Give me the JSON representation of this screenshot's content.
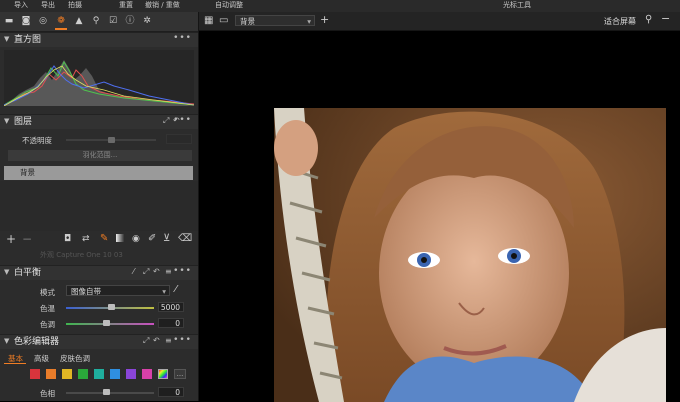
{
  "menu": {
    "import": "导入",
    "export": "导出",
    "capture": "拍摄",
    "reset": "重置",
    "undo_redo": "撤销 / 重做",
    "auto_adjust": "自动调整",
    "cursor_tools": "光标工具"
  },
  "tool_tabs": [
    "folder-icon",
    "camera-icon",
    "lens-icon",
    "color-icon",
    "exposure-icon",
    "details-icon",
    "adjustments-icon",
    "metadata-icon",
    "settings-icon"
  ],
  "histogram": {
    "title": "直方图",
    "more": "•••"
  },
  "layers": {
    "title": "图层",
    "opacity_label": "不透明度",
    "opacity_value": "",
    "feather_button": "羽化范围...",
    "background_layer": "背景",
    "more": "•••"
  },
  "white_balance": {
    "title": "白平衡",
    "partial_text": "外观    Capture One 10 03",
    "mode_label": "模式",
    "mode_value": "图像自带",
    "kelvin_label": "色温",
    "kelvin_value": "5000",
    "tint_label": "色调",
    "tint_value": "0",
    "more": "•••"
  },
  "color_editor": {
    "title": "色彩编辑器",
    "tabs": [
      "基本",
      "高级",
      "皮肤色调"
    ],
    "swatches": [
      "#d8343c",
      "#e87c2a",
      "#e0b624",
      "#2aa83a",
      "#1fae9e",
      "#2f8fe0",
      "#8a45d8",
      "#d840a8"
    ],
    "hue_label": "色相",
    "hue_value": "0",
    "more": "•••"
  },
  "viewer_toolbar": {
    "layer_select": "背景",
    "fit_label": "适合屏幕"
  },
  "colors": {
    "accent": "#f07d24"
  }
}
